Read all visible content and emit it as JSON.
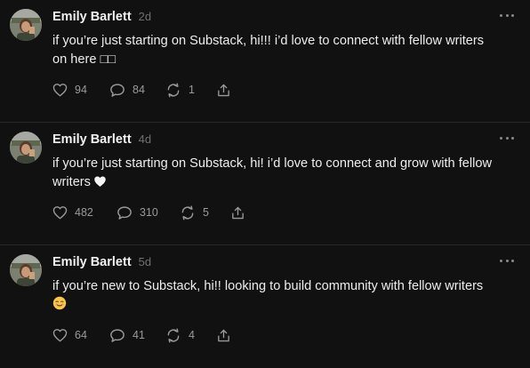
{
  "colors": {
    "background": "#111111",
    "text": "#ededed",
    "muted": "#9a9a9a",
    "divider": "#2a2a2a"
  },
  "posts": [
    {
      "author": "Emily Barlett",
      "time": "2d",
      "text_line1": "if you’re just starting on Substack, hi!!! i’d love to connect with fellow writers",
      "text_line2": "on here",
      "text_suffix": "□□",
      "emoji": "",
      "likes": "94",
      "comments": "84",
      "reposts": "1"
    },
    {
      "author": "Emily Barlett",
      "time": "4d",
      "text_line1": "if you’re just starting on Substack, hi! i’d love to connect and grow with fellow",
      "text_line2": "writers",
      "text_suffix": "",
      "emoji": "white-heart",
      "likes": "482",
      "comments": "310",
      "reposts": "5"
    },
    {
      "author": "Emily Barlett",
      "time": "5d",
      "text_line1": "if you’re new to Substack, hi!! looking to build community with fellow writers",
      "text_line2": "",
      "text_suffix": "",
      "emoji": "smiling-face",
      "likes": "64",
      "comments": "41",
      "reposts": "4"
    }
  ]
}
